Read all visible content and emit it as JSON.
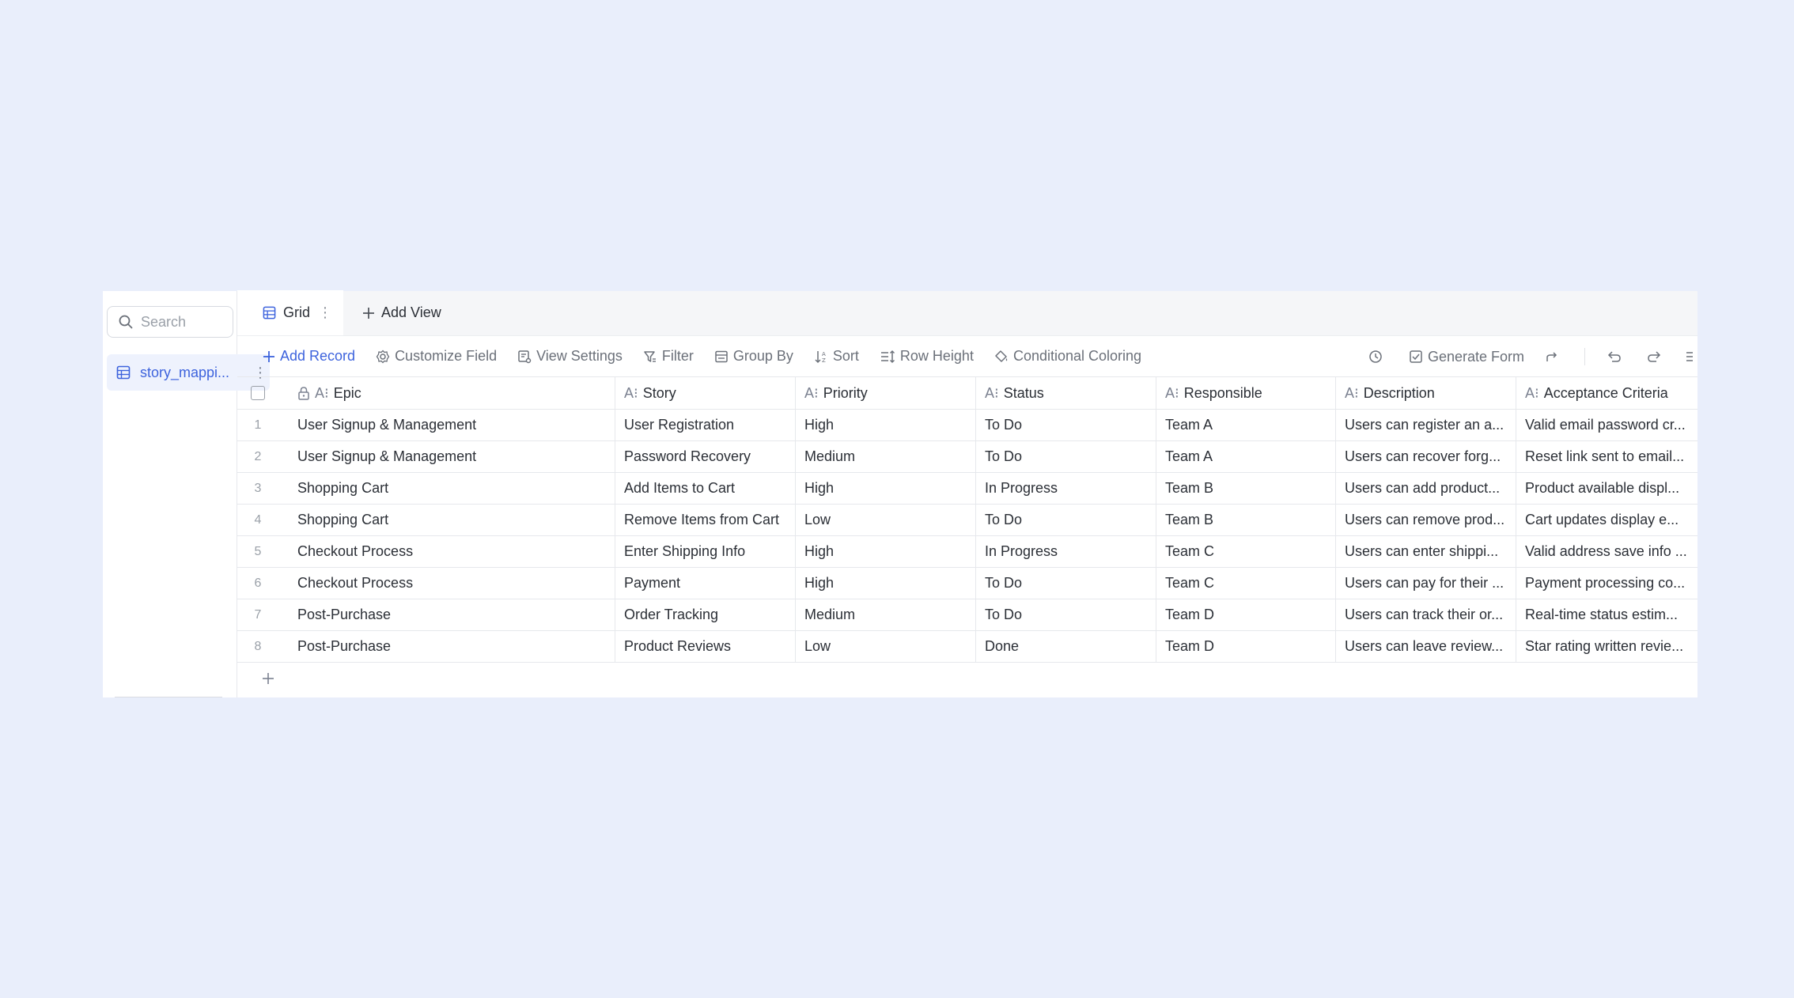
{
  "sidebar": {
    "search_placeholder": "Search",
    "tables": [
      {
        "label": "story_mappi...",
        "icon": "table-icon"
      }
    ]
  },
  "views": {
    "active_tab": "Grid",
    "add_view": "Add View"
  },
  "toolbar": {
    "add_record": "Add Record",
    "customize_field": "Customize Field",
    "view_settings": "View Settings",
    "filter": "Filter",
    "group_by": "Group By",
    "sort": "Sort",
    "row_height": "Row Height",
    "conditional_coloring": "Conditional Coloring",
    "generate_form": "Generate Form"
  },
  "grid": {
    "columns": [
      "Epic",
      "Story",
      "Priority",
      "Status",
      "Responsible",
      "Description",
      "Acceptance Criteria"
    ],
    "rows": [
      {
        "idx": "1",
        "epic": "User Signup & Management",
        "story": "User Registration",
        "priority": "High",
        "status": "To Do",
        "responsible": "Team A",
        "description": "Users can register an a...",
        "acceptance": "Valid email password cr..."
      },
      {
        "idx": "2",
        "epic": "User Signup & Management",
        "story": "Password Recovery",
        "priority": "Medium",
        "status": "To Do",
        "responsible": "Team A",
        "description": "Users can recover forg...",
        "acceptance": "Reset link sent to email..."
      },
      {
        "idx": "3",
        "epic": "Shopping Cart",
        "story": "Add Items to Cart",
        "priority": "High",
        "status": "In Progress",
        "responsible": "Team B",
        "description": "Users can add product...",
        "acceptance": "Product available displ..."
      },
      {
        "idx": "4",
        "epic": "Shopping Cart",
        "story": "Remove Items from Cart",
        "priority": "Low",
        "status": "To Do",
        "responsible": "Team B",
        "description": "Users can remove prod...",
        "acceptance": "Cart updates display e..."
      },
      {
        "idx": "5",
        "epic": "Checkout Process",
        "story": "Enter Shipping Info",
        "priority": "High",
        "status": "In Progress",
        "responsible": "Team C",
        "description": "Users can enter shippi...",
        "acceptance": "Valid address save info ..."
      },
      {
        "idx": "6",
        "epic": "Checkout Process",
        "story": "Payment",
        "priority": "High",
        "status": "To Do",
        "responsible": "Team C",
        "description": "Users can pay for their ...",
        "acceptance": "Payment processing co..."
      },
      {
        "idx": "7",
        "epic": "Post-Purchase",
        "story": "Order Tracking",
        "priority": "Medium",
        "status": "To Do",
        "responsible": "Team D",
        "description": "Users can track their or...",
        "acceptance": "Real-time status estim..."
      },
      {
        "idx": "8",
        "epic": "Post-Purchase",
        "story": "Product Reviews",
        "priority": "Low",
        "status": "Done",
        "responsible": "Team D",
        "description": "Users can leave review...",
        "acceptance": "Star rating written revie..."
      }
    ]
  },
  "colors": {
    "accent": "#3d63dd",
    "page_bg": "#e9eefb"
  }
}
